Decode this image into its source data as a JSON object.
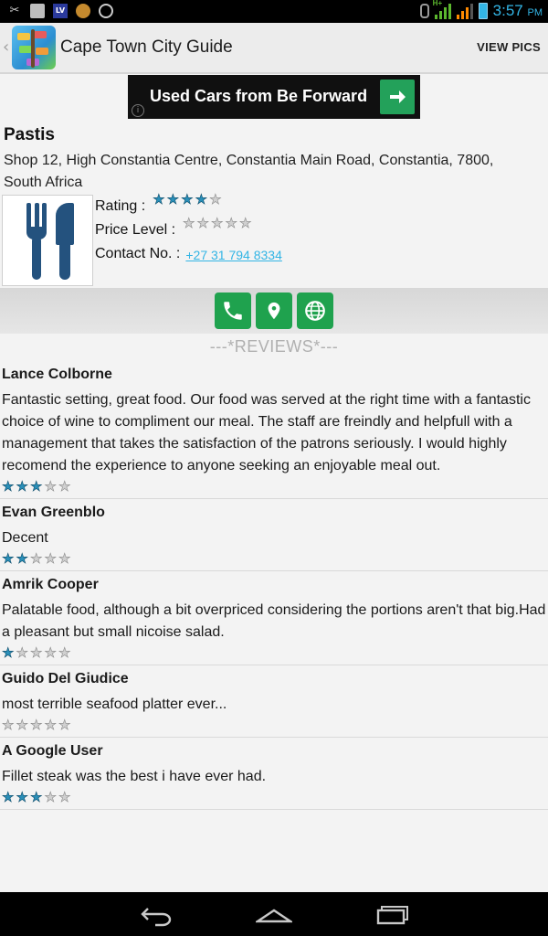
{
  "status_bar": {
    "time": "3:57",
    "ampm": "PM",
    "network": "H+",
    "left_icons": [
      "tools-icon",
      "image-icon",
      "lv-app-icon",
      "coin-icon",
      "wifi-icon"
    ]
  },
  "action_bar": {
    "title": "Cape Town City Guide",
    "view_pics": "VIEW PICS"
  },
  "ad": {
    "text": "Used Cars from Be Forward"
  },
  "place": {
    "name": "Pastis",
    "address": "Shop 12, High Constantia Centre, Constantia Main Road, Constantia, 7800, South Africa",
    "rating_label": "Rating :",
    "rating": 4,
    "price_level_label": "Price Level :",
    "price_level": 0,
    "contact_label": "Contact No. :",
    "contact_number": "+27 31 794 8334"
  },
  "reviews_header": "---*REVIEWS*---",
  "reviews": [
    {
      "author": "Lance Colborne",
      "text": "Fantastic setting, great food. Our food was served at the right time with a fantastic choice of wine to compliment our meal. The staff are freindly and helpfull with a management that takes the satisfaction of the patrons seriously. I would highly recomend the experience to anyone seeking an enjoyable meal out.",
      "rating": 3
    },
    {
      "author": "Evan Greenblo",
      "text": "Decent",
      "rating": 2
    },
    {
      "author": "Amrik Cooper",
      "text": "Palatable food, although a bit overpriced considering the portions aren't that big.Had a pleasant but small nicoise salad.",
      "rating": 1
    },
    {
      "author": "Guido Del Giudice",
      "text": "most terrible seafood platter ever...",
      "rating": 0
    },
    {
      "author": "A Google User",
      "text": "Fillet steak was the best i have ever had.",
      "rating": 3
    }
  ],
  "colors": {
    "accent_blue": "#33b5e5",
    "action_green": "#1fa24e",
    "star_blue": "#2a8fb8",
    "ad_green": "#23a15a"
  }
}
